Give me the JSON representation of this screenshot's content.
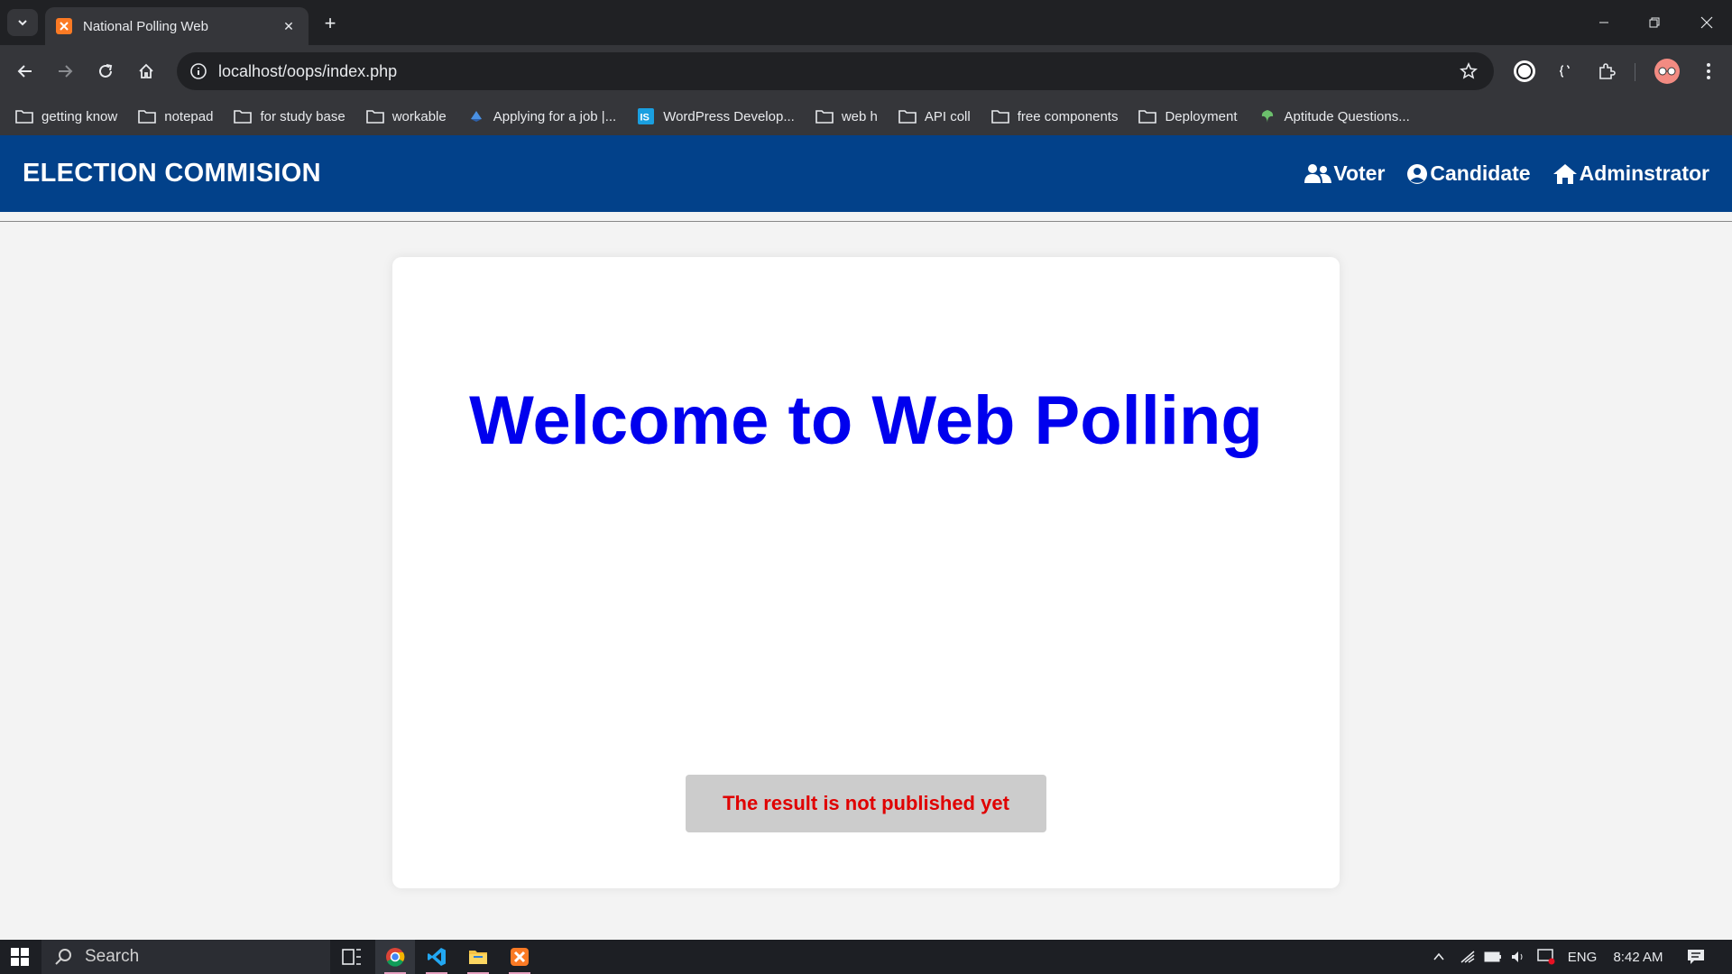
{
  "browser": {
    "tab_title": "National Polling Web",
    "tab_close": "✕",
    "new_tab": "+",
    "url": "localhost/oops/index.php",
    "bookmarks": [
      {
        "label": "getting know",
        "icon": "folder-icon"
      },
      {
        "label": "notepad",
        "icon": "folder-icon"
      },
      {
        "label": "for study base",
        "icon": "folder-icon"
      },
      {
        "label": "workable",
        "icon": "folder-icon"
      },
      {
        "label": "Applying for a job |...",
        "icon": "site-favicon-icon"
      },
      {
        "label": "WordPress Develop...",
        "icon": "is-favicon-icon"
      },
      {
        "label": "web h",
        "icon": "folder-icon"
      },
      {
        "label": "API coll",
        "icon": "folder-icon"
      },
      {
        "label": "free components",
        "icon": "folder-icon"
      },
      {
        "label": "Deployment",
        "icon": "folder-icon"
      },
      {
        "label": "Aptitude Questions...",
        "icon": "site-favicon-icon"
      }
    ]
  },
  "site": {
    "brand": "ELECTION COMMISION",
    "nav": {
      "voter": "Voter",
      "candidate": "Candidate",
      "administrator": "Adminstrator"
    },
    "heading": "Welcome to Web Polling",
    "result_notice": "The result is not published yet",
    "colors": {
      "header_bg": "#02418a",
      "heading": "#0000ee",
      "notice_text": "#e00000",
      "notice_bg": "#cccccc"
    }
  },
  "taskbar": {
    "search_placeholder": "Search",
    "language": "ENG",
    "time": "8:42 AM"
  }
}
